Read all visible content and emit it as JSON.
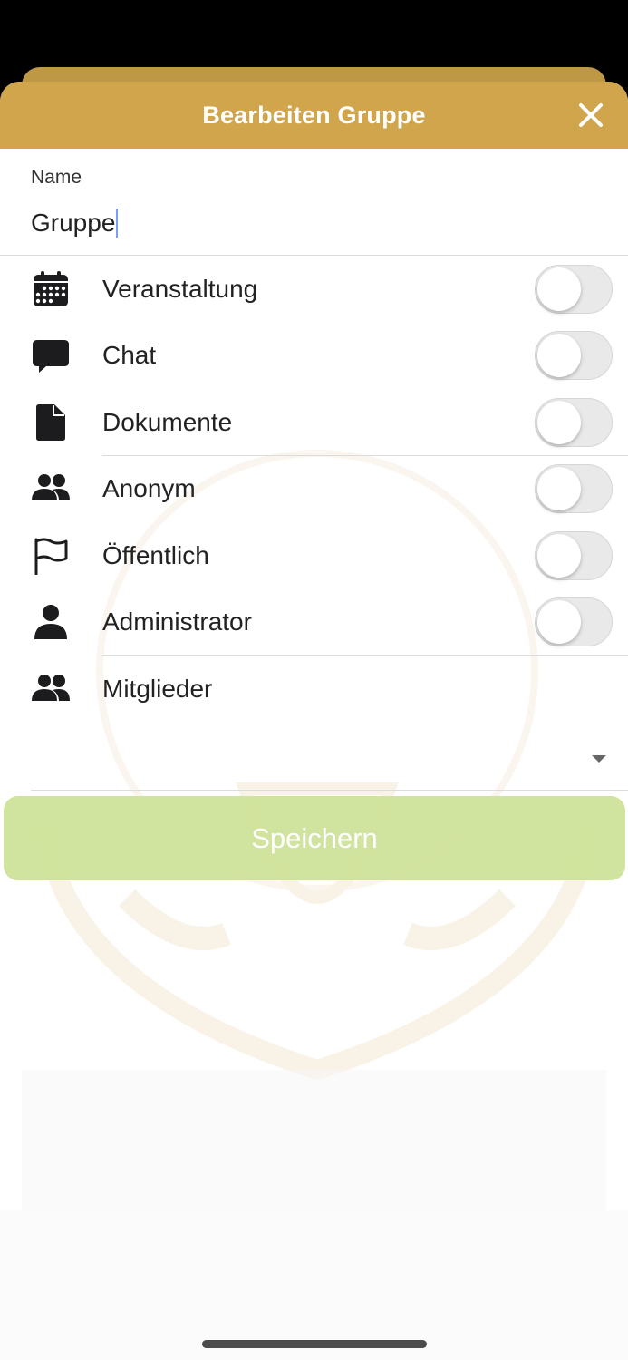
{
  "header": {
    "title": "Bearbeiten Gruppe",
    "close_icon": "close-icon"
  },
  "name_field": {
    "label": "Name",
    "value": "Gruppe"
  },
  "options": [
    {
      "label": "Veranstaltung",
      "icon": "calendar-icon",
      "enabled": false
    },
    {
      "label": "Chat",
      "icon": "chat-bubble-icon",
      "enabled": false
    },
    {
      "label": "Dokumente",
      "icon": "document-icon",
      "enabled": false
    },
    {
      "label": "Anonym",
      "icon": "users-icon",
      "enabled": false
    },
    {
      "label": "Öffentlich",
      "icon": "flag-icon",
      "enabled": false
    },
    {
      "label": "Administrator",
      "icon": "person-icon",
      "enabled": false
    }
  ],
  "members": {
    "label": "Mitglieder",
    "icon": "users-icon",
    "selected": ""
  },
  "save_button": {
    "label": "Speichern"
  },
  "colors": {
    "header": "#d0a54c",
    "save_button": "#cfe39a",
    "toggle_off": "#e9e9ea"
  }
}
